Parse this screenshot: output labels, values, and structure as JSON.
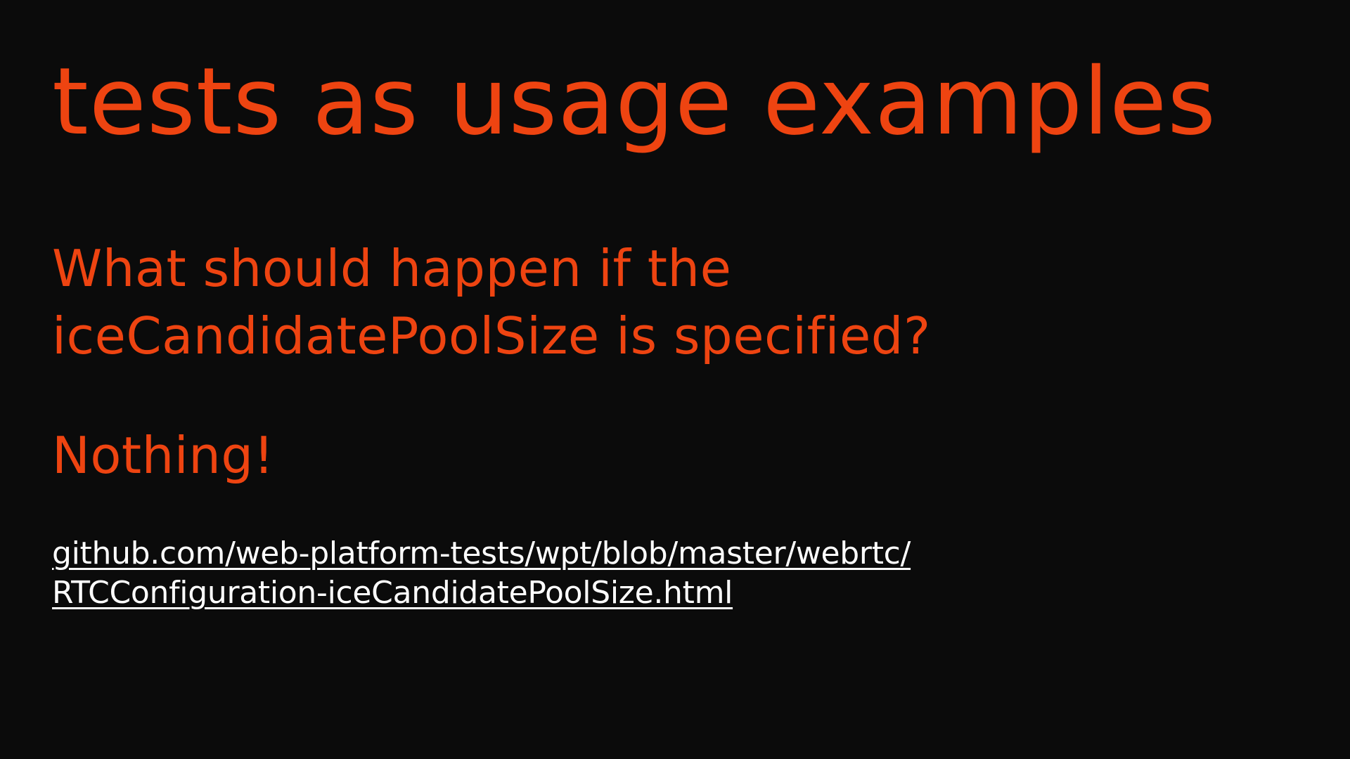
{
  "slide": {
    "title": "tests as usage examples",
    "question_line1": "What should happen if the",
    "question_line2": "iceCandidatePoolSize is specified?",
    "answer": "Nothing!",
    "link_line1": "github.com/web-platform-tests/wpt/blob/master/webrtc/",
    "link_line2": "RTCConfiguration-iceCandidatePoolSize.html"
  },
  "colors": {
    "background": "#0b0b0b",
    "accent": "#ee4411",
    "link": "#ffffff"
  }
}
